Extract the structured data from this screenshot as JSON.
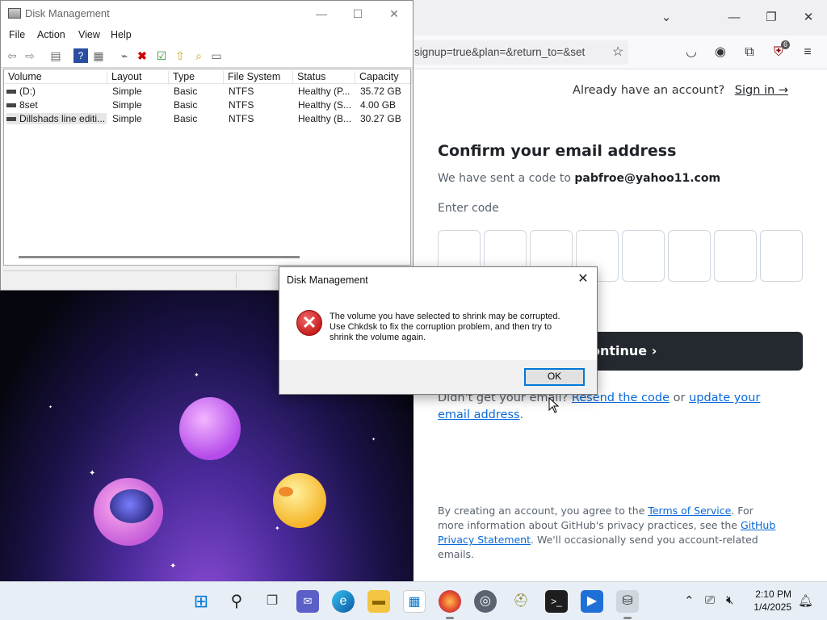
{
  "disk_management": {
    "title": "Disk Management",
    "menu": [
      "File",
      "Action",
      "View",
      "Help"
    ],
    "columns": [
      "Volume",
      "Layout",
      "Type",
      "File System",
      "Status",
      "Capacity"
    ],
    "rows": [
      {
        "volume": "(D:)",
        "layout": "Simple",
        "type": "Basic",
        "fs": "NTFS",
        "status": "Healthy (P...",
        "capacity": "35.72 GB"
      },
      {
        "volume": "8set",
        "layout": "Simple",
        "type": "Basic",
        "fs": "NTFS",
        "status": "Healthy (S...",
        "capacity": "4.00 GB"
      },
      {
        "volume": "Dillshads line editi...",
        "layout": "Simple",
        "type": "Basic",
        "fs": "NTFS",
        "status": "Healthy (B...",
        "capacity": "30.27 GB"
      }
    ]
  },
  "dialog": {
    "title": "Disk Management",
    "message_lines": [
      "The volume you have selected to shrink may be corrupted.",
      "Use Chkdsk to fix the corruption problem, and then try to",
      "shrink the volume again."
    ],
    "ok_label": "OK"
  },
  "browser": {
    "url": "signup=true&plan=&return_to=&set",
    "extension_badge": "6"
  },
  "github": {
    "already": "Already have an account?",
    "sign_in": "Sign in →",
    "title": "Confirm your email address",
    "sent_prefix": "We have sent a code to",
    "email": "pabfroe@yahoo11.com",
    "enter_code": "Enter code",
    "continue": "Continue ›",
    "continue_visible": "ontinue ›",
    "didnt_prefix": "Didn't get your email?",
    "resend": "Resend the code",
    "or": "or",
    "update": "update your email address",
    "legal_1": "By creating an account, you agree to the",
    "terms": "Terms of Service",
    "legal_2": ". For more information about GitHub's privacy practices, see the",
    "privacy": "GitHub Privacy Statement",
    "legal_3": ". We'll occasionally send you account-related emails."
  },
  "taskbar": {
    "time": "2:10 PM",
    "date": "1/4/2025"
  },
  "colors": {
    "link": "#0969da",
    "error_red": "#c81d1d",
    "dialog_focus": "#0078d7"
  }
}
